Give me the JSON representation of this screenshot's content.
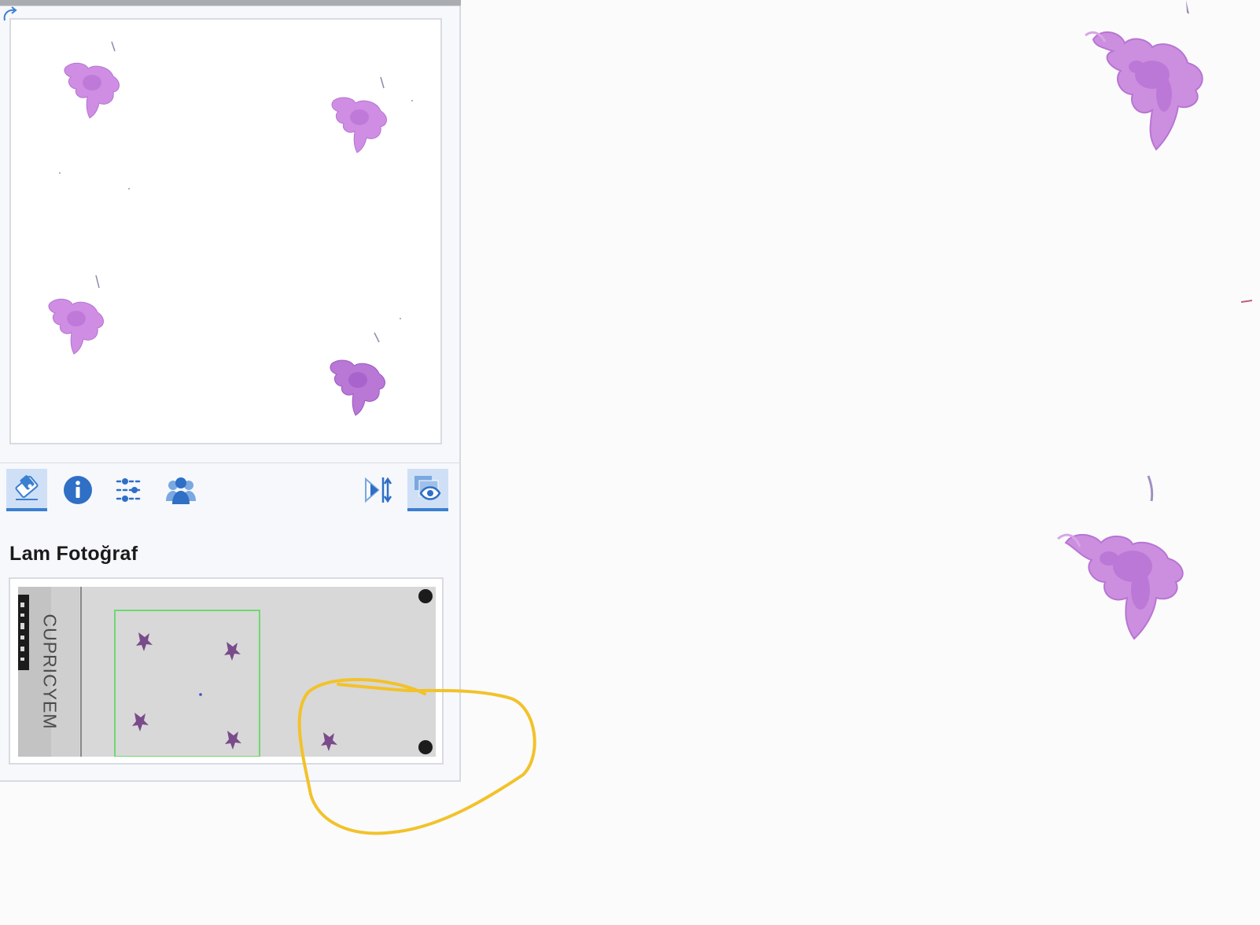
{
  "panel": {
    "section_title": "Lam Fotoğraf",
    "slide_label": "CUPRICYEM"
  },
  "toolbar": {
    "left_buttons": [
      {
        "icon": "eraser-icon",
        "active": true
      },
      {
        "icon": "info-icon",
        "active": false
      },
      {
        "icon": "sliders-icon",
        "active": false
      },
      {
        "icon": "users-icon",
        "active": false
      }
    ],
    "right_buttons": [
      {
        "icon": "flip-icon",
        "active": false
      },
      {
        "icon": "eye-layers-icon",
        "active": true
      }
    ]
  },
  "colors": {
    "accent": "#3b7fd0",
    "tissue": "#c77fd8",
    "tissue_dark": "#a25abf",
    "selection": "#4cd964",
    "annotation": "#f2c22a"
  }
}
